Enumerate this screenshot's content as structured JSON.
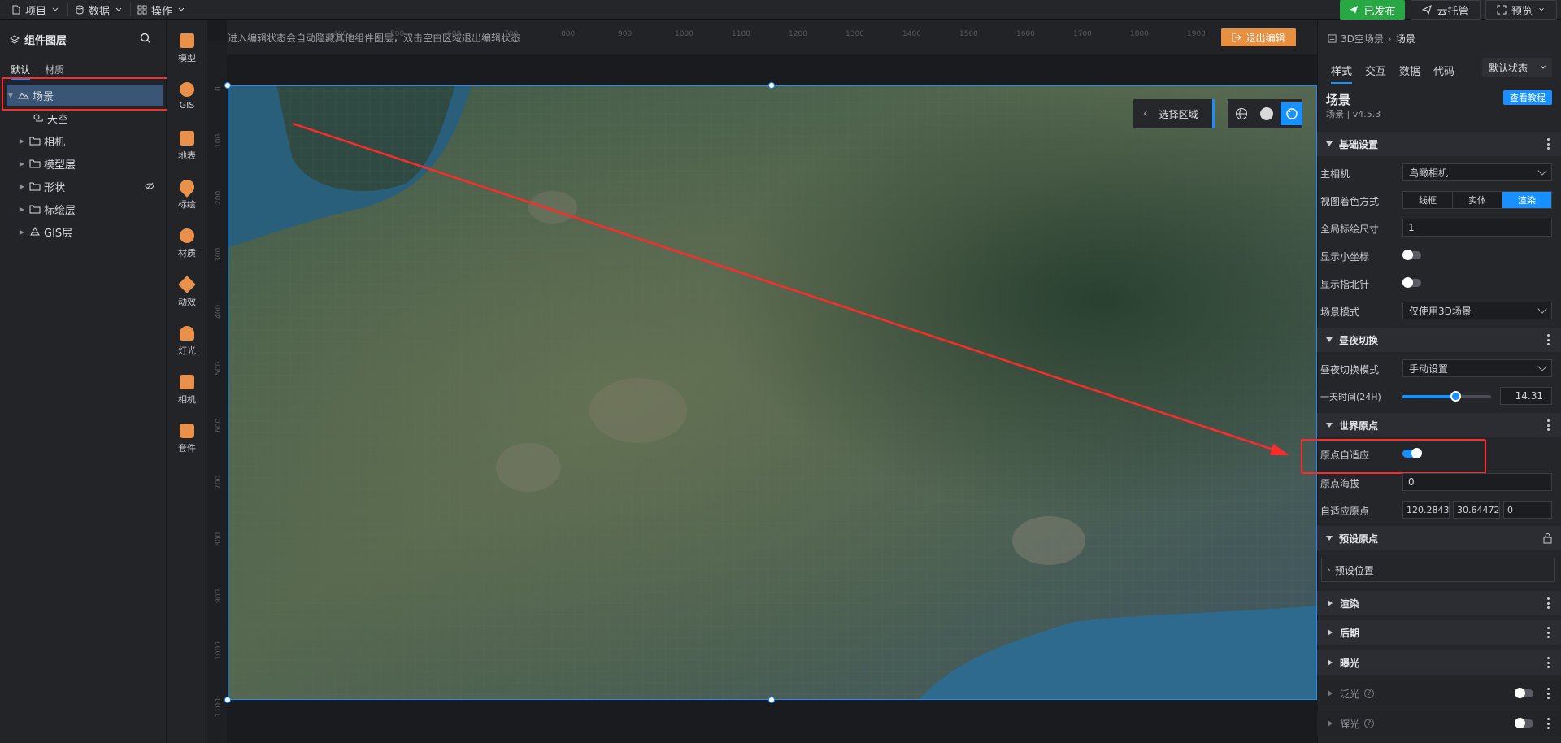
{
  "topbar": {
    "menus": [
      {
        "label": "项目",
        "icon": "file-icon"
      },
      {
        "label": "数据",
        "icon": "database-icon"
      },
      {
        "label": "操作",
        "icon": "grid-icon"
      }
    ],
    "published_label": "已发布",
    "cloud_label": "云托管",
    "preview_label": "预览"
  },
  "left_panel": {
    "title": "组件图层",
    "tabs": [
      "默认",
      "材质"
    ],
    "tree": [
      {
        "label": "场景",
        "selected": true,
        "icon": "scene-icon"
      },
      {
        "label": "天空",
        "icon": "sky-icon"
      },
      {
        "label": "相机",
        "icon": "folder-icon"
      },
      {
        "label": "模型层",
        "icon": "folder-icon"
      },
      {
        "label": "形状",
        "icon": "folder-icon"
      },
      {
        "label": "标绘层",
        "icon": "folder-icon"
      },
      {
        "label": "GIS层",
        "icon": "gis-layer-icon"
      }
    ]
  },
  "icon_bar": [
    {
      "label": "模型"
    },
    {
      "label": "GIS"
    },
    {
      "label": "地表"
    },
    {
      "label": "标绘"
    },
    {
      "label": "材质"
    },
    {
      "label": "动效"
    },
    {
      "label": "灯光"
    },
    {
      "label": "相机"
    },
    {
      "label": "套件"
    }
  ],
  "canvas": {
    "hint": "进入编辑状态会自动隐藏其他组件图层，双击空白区域退出编辑状态",
    "exit_edit_label": "退出编辑",
    "select_area_label": "选择区域",
    "ruler_top": [
      "400",
      "500",
      "600",
      "700",
      "800",
      "900",
      "1000",
      "1100",
      "1200",
      "1300",
      "1400",
      "1500",
      "1600",
      "1700",
      "1800",
      "1900"
    ],
    "ruler_left": [
      "0",
      "100",
      "200",
      "300",
      "400",
      "500",
      "600",
      "700",
      "800",
      "900",
      "1000",
      "1100"
    ]
  },
  "right_panel": {
    "breadcrumb_parent": "3D空场景",
    "breadcrumb_current": "场景",
    "tabs": [
      "样式",
      "交互",
      "数据",
      "代码"
    ],
    "state_select": "默认状态",
    "component_title": "场景",
    "component_sub": "场景 | v4.5.3",
    "tutorial_label": "查看教程",
    "sections": {
      "basic": "基础设置",
      "daynight": "昼夜切换",
      "world_origin": "世界原点",
      "preset_origin": "预设原点",
      "render": "渲染",
      "post": "后期",
      "exposure": "曝光",
      "bloom": "泛光",
      "glow": "辉光"
    },
    "fields": {
      "main_camera_label": "主相机",
      "main_camera_value": "鸟瞰相机",
      "shading_label": "视图着色方式",
      "shading_options": [
        "线框",
        "实体",
        "渲染"
      ],
      "icon_size_label": "全局标绘尺寸",
      "icon_size_value": "1",
      "show_axis_label": "显示小坐标",
      "show_compass_label": "显示指北针",
      "scene_mode_label": "场景模式",
      "scene_mode_value": "仅使用3D场景",
      "daynight_mode_label": "昼夜切换模式",
      "daynight_mode_value": "手动设置",
      "time_label": "一天时间(24H)",
      "time_value": "14.31",
      "time_fraction": 0.6,
      "origin_adapt_label": "原点自适应",
      "origin_alt_label": "原点海拔",
      "origin_alt_value": "0",
      "adapt_origin_label": "自适应原点",
      "adapt_origin_values": [
        "120.28437",
        "30.644729",
        "0"
      ],
      "preset_position_label": "预设位置"
    }
  },
  "colors": {
    "accent": "#1890ff",
    "published_green": "#27a844",
    "exit_orange": "#e8903f",
    "highlight_red": "#ff2a2a",
    "selected_row": "#3b5577"
  }
}
